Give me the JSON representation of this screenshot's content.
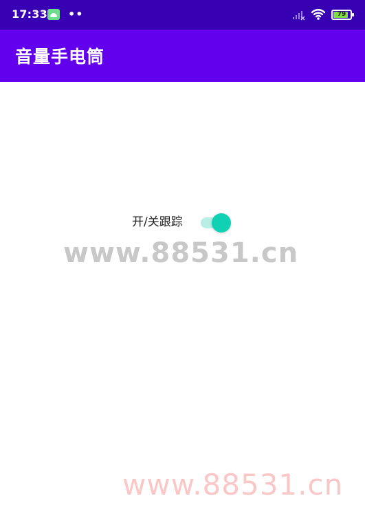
{
  "status_bar": {
    "time": "17:33",
    "dots": "••",
    "battery_level": "79",
    "icons": {
      "app": "android-app-icon",
      "signal": "signal-icon",
      "wifi": "wifi-icon",
      "battery": "battery-icon"
    },
    "colors": {
      "background": "#3700b3",
      "battery_fill": "#7fde43"
    }
  },
  "app_bar": {
    "title": "音量手电筒",
    "background": "#6200ee"
  },
  "main": {
    "tracking_switch": {
      "label": "开/关跟踪",
      "checked": true,
      "thumb_color": "#11d1b4",
      "track_color": "#b9eee4"
    }
  },
  "watermarks": {
    "center_text": "www.88531.cn",
    "bottom_text": "www.88531.cn"
  }
}
